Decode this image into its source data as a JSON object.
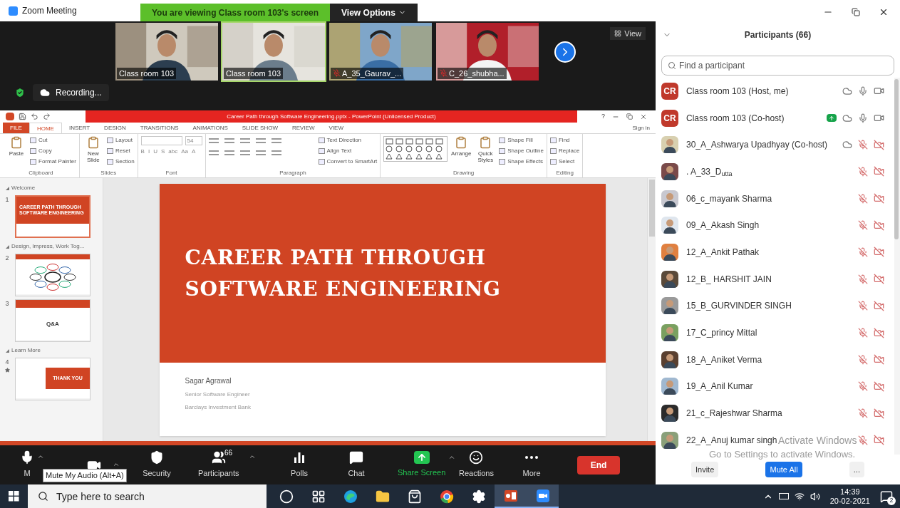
{
  "window": {
    "title": "Zoom Meeting"
  },
  "share_banner": {
    "text": "You are viewing Class room 103's screen",
    "view_options": "View Options"
  },
  "videos": [
    {
      "name": "Class room 103",
      "muted": false,
      "selected": false
    },
    {
      "name": "Class room 103",
      "muted": false,
      "selected": true
    },
    {
      "name": "A_35_Gaurav_...",
      "muted": true,
      "selected": false
    },
    {
      "name": "C_26_shubha...",
      "muted": true,
      "selected": false
    }
  ],
  "view_button": "View",
  "recording": "Recording...",
  "powerpoint": {
    "title": "Career Path through Software Engineering.pptx - PowerPoint (Unlicensed Product)",
    "help": "?",
    "tabs": [
      {
        "label": "FILE",
        "kind": "file",
        "selected": false
      },
      {
        "label": "HOME",
        "kind": "tab",
        "selected": true
      },
      {
        "label": "INSERT",
        "kind": "tab",
        "selected": false
      },
      {
        "label": "DESIGN",
        "kind": "tab",
        "selected": false
      },
      {
        "label": "TRANSITIONS",
        "kind": "tab",
        "selected": false
      },
      {
        "label": "ANIMATIONS",
        "kind": "tab",
        "selected": false
      },
      {
        "label": "SLIDE SHOW",
        "kind": "tab",
        "selected": false
      },
      {
        "label": "REVIEW",
        "kind": "tab",
        "selected": false
      },
      {
        "label": "VIEW",
        "kind": "tab",
        "selected": false
      }
    ],
    "sign_in": "Sign in",
    "groups": [
      {
        "title": "Clipboard",
        "kind": "clipboard",
        "large": [
          "Paste"
        ],
        "small": [
          "Cut",
          "Copy",
          "Format Painter"
        ]
      },
      {
        "title": "Slides",
        "kind": "slides",
        "large": [
          "New Slide"
        ],
        "small": [
          "Layout",
          "Reset",
          "Section"
        ]
      },
      {
        "title": "Font",
        "kind": "font",
        "field": "54",
        "format": [
          "B",
          "I",
          "U",
          "S",
          "abc",
          "Aa",
          "A"
        ]
      },
      {
        "title": "Paragraph",
        "kind": "paragraph",
        "small": [
          "Text Direction",
          "Align Text",
          "Convert to SmartArt"
        ]
      },
      {
        "title": "Drawing",
        "kind": "drawing",
        "large": [
          "Arrange",
          "Quick Styles"
        ],
        "small": [
          "Shape Fill",
          "Shape Outline",
          "Shape Effects"
        ]
      },
      {
        "title": "Editing",
        "kind": "editing",
        "small": [
          "Find",
          "Replace",
          "Select"
        ]
      }
    ],
    "sections": [
      {
        "title": "Welcome",
        "slides": [
          {
            "number": "1",
            "kind": "title",
            "selected": true,
            "text": "CAREER PATH THROUGH SOFTWARE ENGINEERING"
          }
        ]
      },
      {
        "title": "Design, Impress, Work Tog...",
        "slides": [
          {
            "number": "2",
            "kind": "diagram",
            "selected": false
          },
          {
            "number": "3",
            "kind": "heading",
            "selected": false,
            "text": "Q&A"
          }
        ]
      },
      {
        "title": "Learn More",
        "slides": [
          {
            "number": "4",
            "kind": "box",
            "selected": false,
            "text": "THANK YOU"
          }
        ]
      }
    ],
    "slide": {
      "title": [
        "CAREER PATH THROUGH",
        "SOFTWARE ENGINEERING"
      ],
      "subtitle": [
        "Sagar Agrawal",
        "Senior Software Engineer",
        "Barclays Investment Bank"
      ]
    }
  },
  "toolbar": {
    "items": [
      {
        "kind": "mic",
        "label": "M",
        "caret": true
      },
      {
        "kind": "video",
        "caret": true
      },
      {
        "kind": "security",
        "label": "Security",
        "caret": false
      },
      {
        "kind": "participants",
        "label": "Participants",
        "count": "66",
        "caret": true
      },
      {
        "kind": "polls",
        "label": "Polls",
        "caret": false
      },
      {
        "kind": "chat",
        "label": "Chat",
        "caret": false
      },
      {
        "kind": "share",
        "label": "Share Screen",
        "caret": true
      },
      {
        "kind": "reactions",
        "label": "Reactions",
        "caret": false
      },
      {
        "kind": "more",
        "label": "More",
        "caret": false
      }
    ],
    "end": "End",
    "tooltip": "Mute My Audio (Alt+A)"
  },
  "participants": {
    "title": "Participants (66)",
    "search": {
      "placeholder": "Find a participant"
    },
    "rows": [
      {
        "name": "Class room 103 (Host, me)",
        "kind": "initials",
        "initials": "CR",
        "sharing": false,
        "cloud": true,
        "muted": false,
        "video_off": false
      },
      {
        "name": "Class room 103 (Co-host)",
        "kind": "initials",
        "initials": "CR",
        "sharing": true,
        "cloud": true,
        "muted": false,
        "video_off": false
      },
      {
        "name": "30_A_Ashwarya Upadhyay (Co-host)",
        "kind": "picture",
        "sharing": false,
        "cloud": true,
        "muted": true,
        "video_off": true
      },
      {
        "name": ". A_33_D$_{utta}$",
        "kind": "picture",
        "sharing": false,
        "cloud": false,
        "muted": true,
        "video_off": true
      },
      {
        "name": "06_c_mayank Sharma",
        "kind": "picture",
        "sharing": false,
        "cloud": false,
        "muted": true,
        "video_off": true
      },
      {
        "name": "09_A_Akash Singh",
        "kind": "picture",
        "sharing": false,
        "cloud": false,
        "muted": true,
        "video_off": true
      },
      {
        "name": "12_A_Ankit Pathak",
        "kind": "picture",
        "sharing": false,
        "cloud": false,
        "muted": true,
        "video_off": true
      },
      {
        "name": "12_B_ HARSHIT JAIN",
        "kind": "picture",
        "sharing": false,
        "cloud": false,
        "muted": true,
        "video_off": true
      },
      {
        "name": "15_B_GURVINDER SINGH",
        "kind": "picture",
        "sharing": false,
        "cloud": false,
        "muted": true,
        "video_off": true
      },
      {
        "name": "17_C_princy Mittal",
        "kind": "picture",
        "sharing": false,
        "cloud": false,
        "muted": true,
        "video_off": true
      },
      {
        "name": "18_A_Aniket Verma",
        "kind": "picture",
        "sharing": false,
        "cloud": false,
        "muted": true,
        "video_off": true
      },
      {
        "name": "19_A_Anil Kumar",
        "kind": "picture",
        "sharing": false,
        "cloud": false,
        "muted": true,
        "video_off": true
      },
      {
        "name": "21_c_Rajeshwar Sharma",
        "kind": "picture",
        "sharing": false,
        "cloud": false,
        "muted": true,
        "video_off": true
      },
      {
        "name": "22_A_Anuj kumar singh",
        "kind": "picture",
        "sharing": false,
        "cloud": false,
        "muted": true,
        "video_off": true
      }
    ],
    "buttons": [
      {
        "label": "Invite",
        "kind": "plain"
      },
      {
        "label": "Mute All",
        "kind": "primary"
      },
      {
        "label": "...",
        "kind": "plain"
      }
    ]
  },
  "os_notice": {
    "title": "Activate Windows",
    "text": "Go to Settings to activate Windows."
  },
  "taskbar": {
    "search": {
      "placeholder": "Type here to search"
    },
    "apps": [
      {
        "kind": "cortana",
        "active": false
      },
      {
        "kind": "taskview",
        "active": false
      },
      {
        "kind": "edge",
        "active": false
      },
      {
        "kind": "explorer",
        "active": false
      },
      {
        "kind": "store",
        "active": false
      },
      {
        "kind": "chrome",
        "active": false
      },
      {
        "kind": "settings",
        "active": false
      },
      {
        "kind": "powerpoint",
        "active": true
      },
      {
        "kind": "zoom",
        "active": true
      }
    ],
    "time": "14:39",
    "date": "20-02-2021",
    "notifications": "2"
  }
}
